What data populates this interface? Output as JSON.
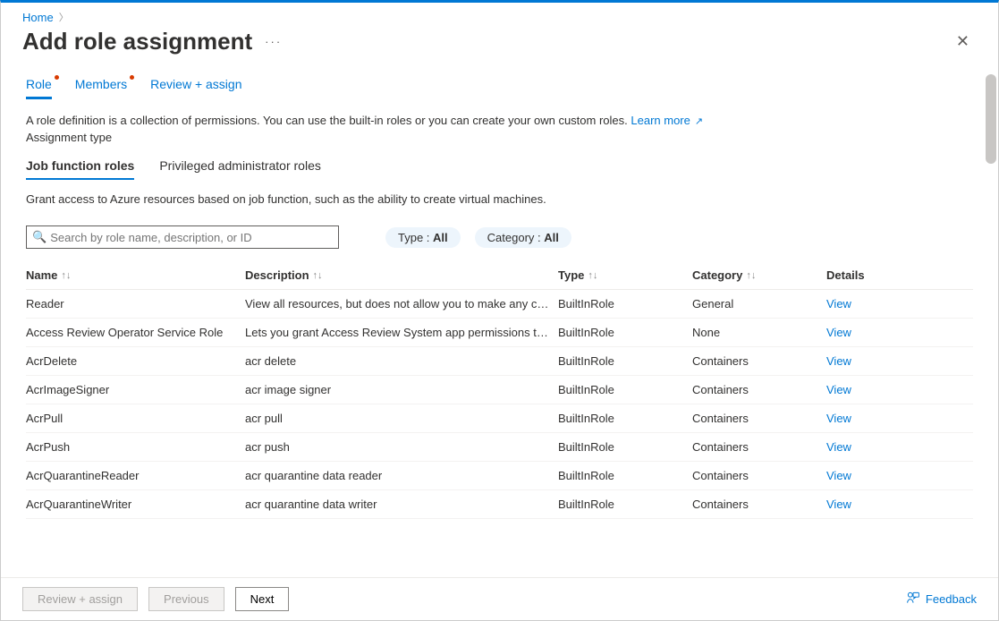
{
  "breadcrumb": {
    "home": "Home"
  },
  "header": {
    "title": "Add role assignment",
    "more": "···"
  },
  "tabs": [
    {
      "id": "role",
      "label": "Role",
      "active": true,
      "dot": true
    },
    {
      "id": "members",
      "label": "Members",
      "active": false,
      "dot": true
    },
    {
      "id": "review",
      "label": "Review + assign",
      "active": false,
      "dot": false
    }
  ],
  "description": {
    "text": "A role definition is a collection of permissions. You can use the built-in roles or you can create your own custom roles.",
    "learn_more": "Learn more"
  },
  "assignment_type_label": "Assignment type",
  "subtabs": [
    {
      "label": "Job function roles",
      "active": true
    },
    {
      "label": "Privileged administrator roles",
      "active": false
    }
  ],
  "subdesc": "Grant access to Azure resources based on job function, such as the ability to create virtual machines.",
  "search_placeholder": "Search by role name, description, or ID",
  "filters": {
    "type_label": "Type : ",
    "type_value": "All",
    "category_label": "Category : ",
    "category_value": "All"
  },
  "columns": {
    "name": "Name",
    "description": "Description",
    "type": "Type",
    "category": "Category",
    "details": "Details"
  },
  "view_label": "View",
  "roles": [
    {
      "name": "Reader",
      "desc": "View all resources, but does not allow you to make any ch…",
      "type": "BuiltInRole",
      "category": "General"
    },
    {
      "name": "Access Review Operator Service Role",
      "desc": "Lets you grant Access Review System app permissions to …",
      "type": "BuiltInRole",
      "category": "None"
    },
    {
      "name": "AcrDelete",
      "desc": "acr delete",
      "type": "BuiltInRole",
      "category": "Containers"
    },
    {
      "name": "AcrImageSigner",
      "desc": "acr image signer",
      "type": "BuiltInRole",
      "category": "Containers"
    },
    {
      "name": "AcrPull",
      "desc": "acr pull",
      "type": "BuiltInRole",
      "category": "Containers"
    },
    {
      "name": "AcrPush",
      "desc": "acr push",
      "type": "BuiltInRole",
      "category": "Containers"
    },
    {
      "name": "AcrQuarantineReader",
      "desc": "acr quarantine data reader",
      "type": "BuiltInRole",
      "category": "Containers"
    },
    {
      "name": "AcrQuarantineWriter",
      "desc": "acr quarantine data writer",
      "type": "BuiltInRole",
      "category": "Containers"
    }
  ],
  "footer": {
    "review": "Review + assign",
    "previous": "Previous",
    "next": "Next",
    "feedback": "Feedback"
  }
}
